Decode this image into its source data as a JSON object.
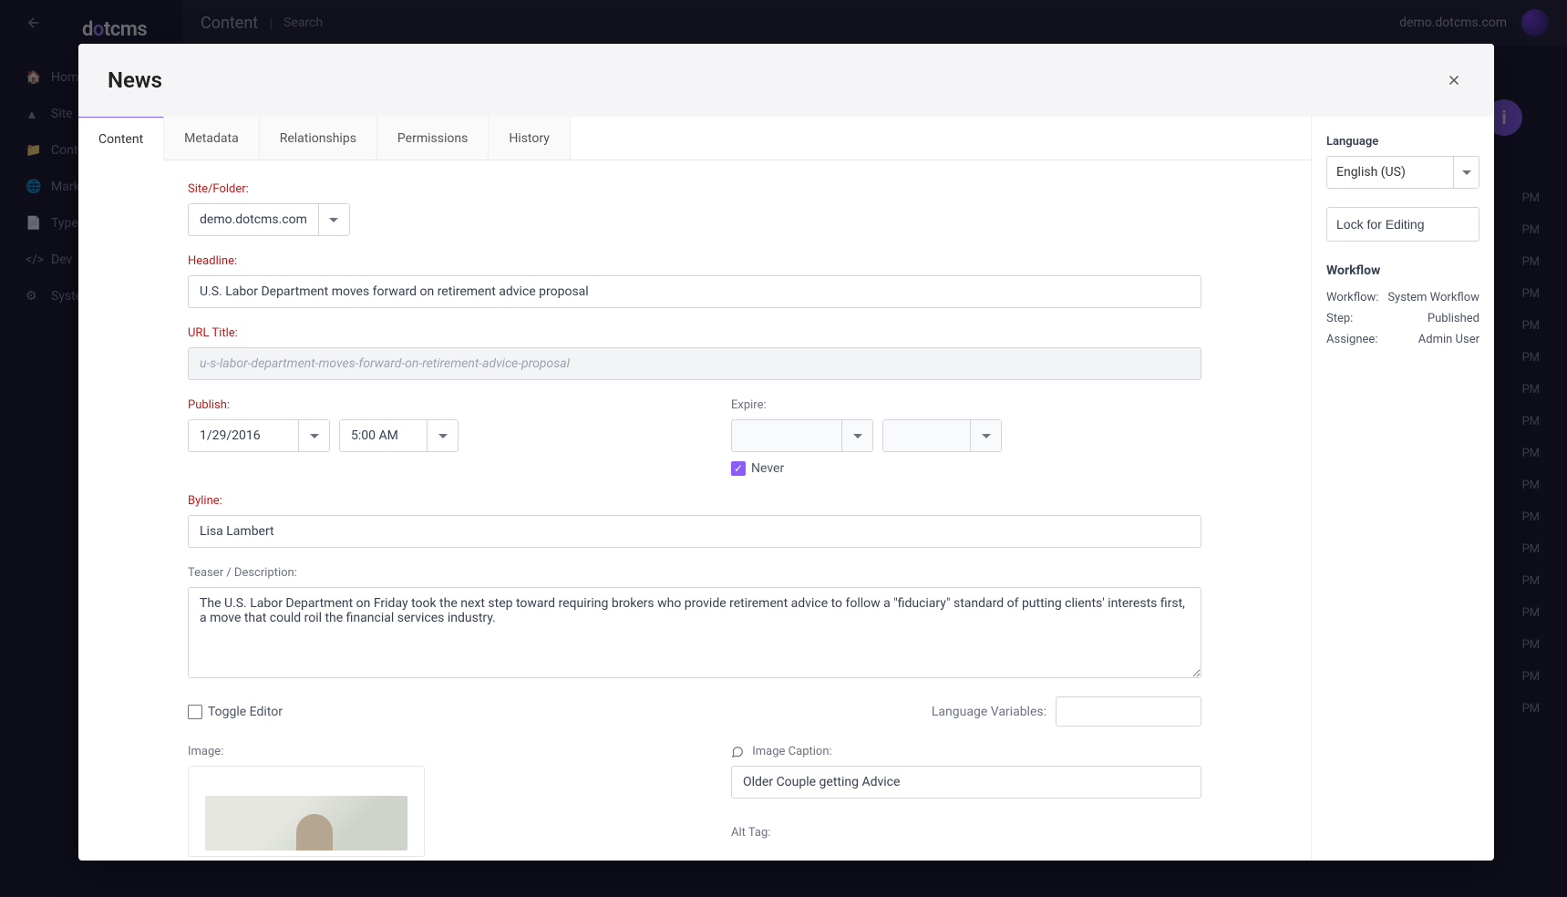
{
  "app": {
    "logo_pre": "d",
    "logo_mid": "o",
    "logo_post": "t",
    "logo_brand": "cms",
    "site": "demo.dotcms.com",
    "header_section": "Content",
    "header_sub": "Search",
    "nav": [
      {
        "label": "Home"
      },
      {
        "label": "Site"
      },
      {
        "label": "Content"
      },
      {
        "label": "Marketing"
      },
      {
        "label": "Types"
      },
      {
        "label": "Dev"
      },
      {
        "label": "System"
      }
    ],
    "bg_times": [
      "PM",
      "PM",
      "PM",
      "PM",
      "PM",
      "PM",
      "PM",
      "PM",
      "PM",
      "PM",
      "PM",
      "PM",
      "PM",
      "PM",
      "PM",
      "PM",
      "PM"
    ]
  },
  "modal": {
    "title": "News",
    "tabs": [
      "Content",
      "Metadata",
      "Relationships",
      "Permissions",
      "History"
    ],
    "active_tab": 0
  },
  "form": {
    "site_folder_label": "Site/Folder:",
    "site_folder_value": "demo.dotcms.com",
    "headline_label": "Headline:",
    "headline_value": "U.S. Labor Department moves forward on retirement advice proposal",
    "urltitle_label": "URL Title:",
    "urltitle_value": "u-s-labor-department-moves-forward-on-retirement-advice-proposal",
    "publish_label": "Publish:",
    "publish_date": "1/29/2016",
    "publish_time": "5:00 AM",
    "expire_label": "Expire:",
    "expire_never_label": "Never",
    "expire_never_checked": true,
    "byline_label": "Byline:",
    "byline_value": "Lisa Lambert",
    "teaser_label": "Teaser / Description:",
    "teaser_value": "The U.S. Labor Department on Friday took the next step toward requiring brokers who provide retirement advice to follow a \"fiduciary\" standard of putting clients' interests first, a move that could roil the financial services industry.",
    "toggle_editor_label": "Toggle Editor",
    "lang_var_label": "Language Variables:",
    "image_label": "Image:",
    "image_caption_label": "Image Caption:",
    "image_caption_value": "Older Couple getting Advice",
    "alt_tag_label": "Alt Tag:"
  },
  "side": {
    "language_label": "Language",
    "language_value": "English (US)",
    "lock_label": "Lock for Editing",
    "workflow_label": "Workflow",
    "rows": [
      {
        "k": "Workflow:",
        "v": "System Workflow"
      },
      {
        "k": "Step:",
        "v": "Published"
      },
      {
        "k": "Assignee:",
        "v": "Admin User"
      }
    ]
  }
}
